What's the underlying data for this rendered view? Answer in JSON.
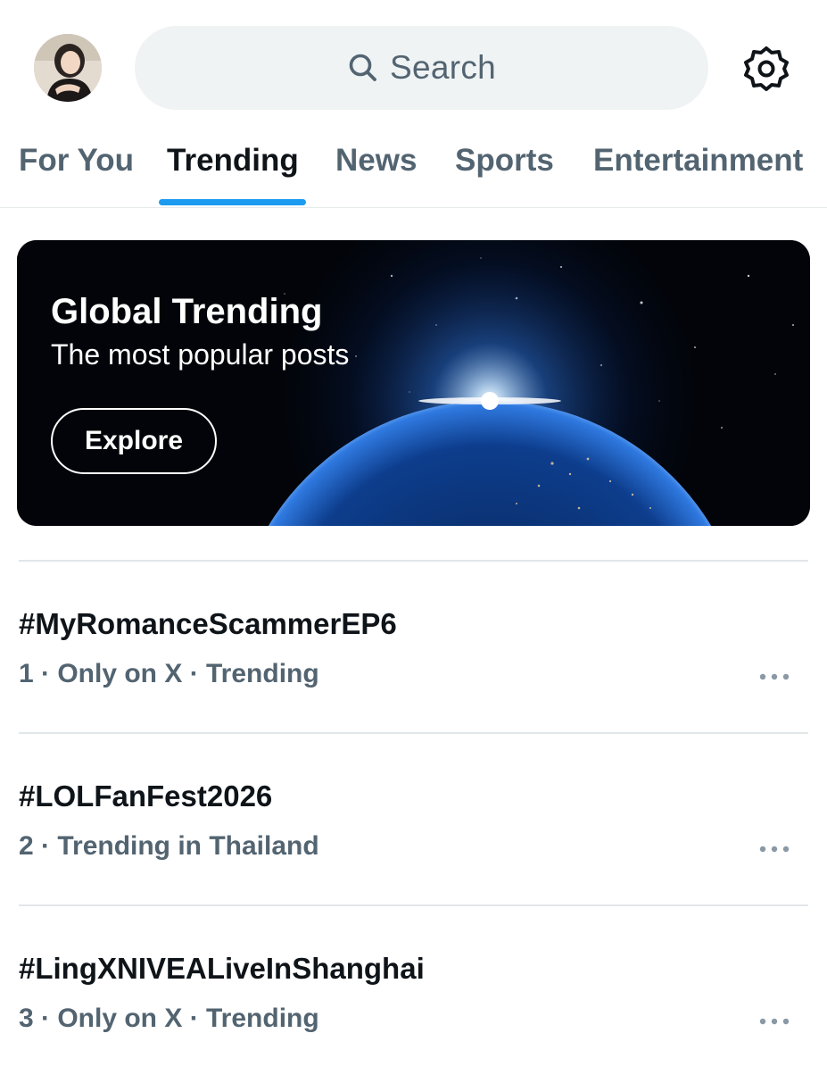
{
  "header": {
    "search": {
      "placeholder": "Search",
      "icon": "search-icon"
    },
    "settings_icon": "gear-icon",
    "avatar": "profile-avatar"
  },
  "tabs": [
    {
      "label": "For You",
      "active": false
    },
    {
      "label": "Trending",
      "active": true
    },
    {
      "label": "News",
      "active": false
    },
    {
      "label": "Sports",
      "active": false
    },
    {
      "label": "Entertainment",
      "active": false
    }
  ],
  "banner": {
    "title": "Global Trending",
    "subtitle": "The most popular posts",
    "button_label": "Explore"
  },
  "trends": [
    {
      "rank": "1",
      "name": "#MyRomanceScammerEP6",
      "meta": "1 · Only on X · Trending"
    },
    {
      "rank": "2",
      "name": "#LOLFanFest2026",
      "meta": "2 · Trending in Thailand"
    },
    {
      "rank": "3",
      "name": "#LingXNIVEALiveInShanghai",
      "meta": "3 · Only on X · Trending"
    }
  ],
  "colors": {
    "accent": "#1d9bf0",
    "text_primary": "#0f1419",
    "text_secondary": "#536471",
    "search_bg": "#eff3f4"
  }
}
